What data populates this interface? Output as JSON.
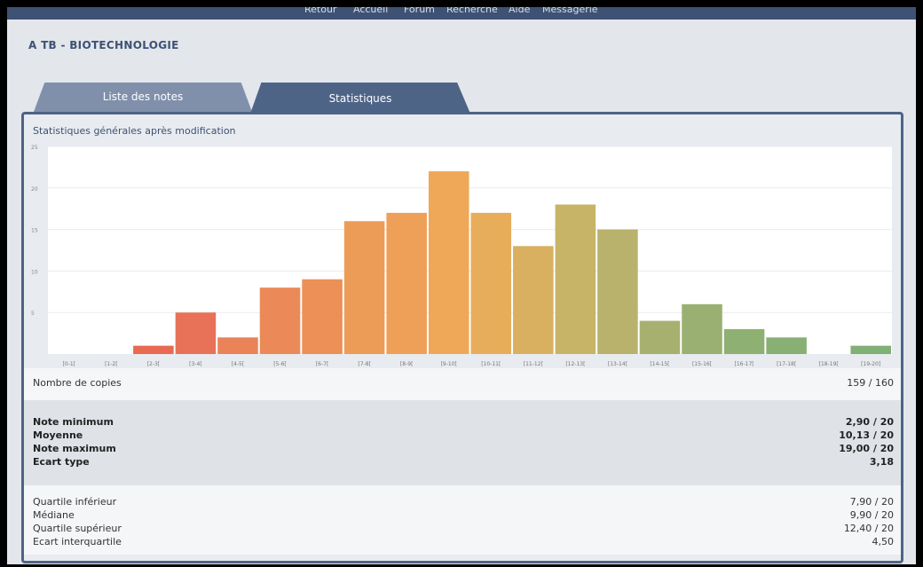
{
  "nav": {
    "items": [
      "Retour",
      "Accueil",
      "Forum",
      "Recherche",
      "Aide",
      "Messagerie"
    ]
  },
  "course": {
    "title": "A TB  -  BIOTECHNOLOGIE"
  },
  "tabs": [
    {
      "label": "Liste des notes",
      "active": false
    },
    {
      "label": "Statistiques",
      "active": true
    }
  ],
  "panel": {
    "title": "Statistiques générales après modification"
  },
  "chart_data": {
    "type": "bar",
    "categories": [
      "[0-1[",
      "[1-2[",
      "[2-3[",
      "[3-4[",
      "[4-5[",
      "[5-6[",
      "[6-7[",
      "[7-8[",
      "[8-9[",
      "[9-10[",
      "[10-11[",
      "[11-12[",
      "[12-13[",
      "[13-14[",
      "[14-15[",
      "[15-16[",
      "[16-17[",
      "[17-18[",
      "[18-19[",
      "[19-20]"
    ],
    "values": [
      0,
      0,
      1,
      5,
      2,
      8,
      9,
      16,
      17,
      22,
      17,
      13,
      18,
      15,
      4,
      6,
      3,
      2,
      0,
      1
    ],
    "colors": [
      "#e85a50",
      "#e85f50",
      "#e86a52",
      "#e87258",
      "#ea8358",
      "#eb8a58",
      "#ec9058",
      "#ed9c58",
      "#eea058",
      "#eea858",
      "#e8ad5a",
      "#d8b060",
      "#c8b466",
      "#b8b26c",
      "#a8b070",
      "#9ab072",
      "#8eb072",
      "#88b074",
      "#84b074",
      "#80b074"
    ],
    "yticks": [
      5,
      10,
      15,
      20,
      25
    ],
    "ylim": [
      0,
      25
    ],
    "grid": true,
    "title": "",
    "xlabel": "",
    "ylabel": ""
  },
  "stats": {
    "copies": {
      "label": "Nombre de copies",
      "value": "159 / 160"
    },
    "main": [
      {
        "label": "Note minimum",
        "value": "2,90 / 20"
      },
      {
        "label": "Moyenne",
        "value": "10,13 / 20"
      },
      {
        "label": "Note maximum",
        "value": "19,00 / 20"
      },
      {
        "label": "Ecart type",
        "value": "3,18"
      }
    ],
    "quartiles": [
      {
        "label": "Quartile inférieur",
        "value": "7,90 / 20"
      },
      {
        "label": "Médiane",
        "value": "9,90 / 20"
      },
      {
        "label": "Quartile supérieur",
        "value": "12,40 / 20"
      },
      {
        "label": "Ecart interquartile",
        "value": "4,50"
      }
    ]
  }
}
